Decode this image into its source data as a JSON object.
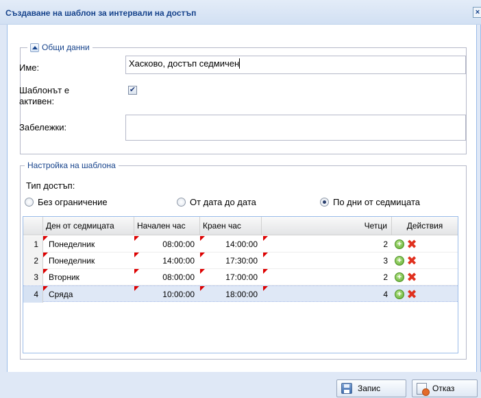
{
  "window": {
    "title": "Създаване на шаблон за интервали на достъп",
    "close_glyph": "×"
  },
  "general": {
    "legend": "Общи данни",
    "name_label": "Име:",
    "name_value": "Хасково, достъп седмичен",
    "active_label_line1": "Шаблонът е",
    "active_label_line2": "активен:",
    "active_checked": true,
    "notes_label": "Забележки:",
    "notes_value": ""
  },
  "settings": {
    "legend": "Настройка на шаблона",
    "access_type_label": "Тип достъп:",
    "options": [
      {
        "label": "Без ограничение",
        "selected": false
      },
      {
        "label": "От дата до дата",
        "selected": false
      },
      {
        "label": "По дни от седмицата",
        "selected": true
      }
    ]
  },
  "grid": {
    "headers": {
      "num": "",
      "day": "Ден от седмицата",
      "start": "Начален час",
      "end": "Краен час",
      "readers": "Четци",
      "actions": "Действия"
    },
    "rows": [
      {
        "num": "1",
        "day": "Понеделник",
        "start": "08:00:00",
        "end": "14:00:00",
        "readers": "2"
      },
      {
        "num": "2",
        "day": "Понеделник",
        "start": "14:00:00",
        "end": "17:30:00",
        "readers": "3"
      },
      {
        "num": "3",
        "day": "Вторник",
        "start": "08:00:00",
        "end": "17:00:00",
        "readers": "2"
      },
      {
        "num": "4",
        "day": "Сряда",
        "start": "10:00:00",
        "end": "18:00:00",
        "readers": "4"
      }
    ],
    "selected_row": 4,
    "icons": {
      "add": "add-icon",
      "delete": "delete-icon"
    }
  },
  "footer": {
    "save_label": "Запис",
    "cancel_label": "Отказ"
  }
}
